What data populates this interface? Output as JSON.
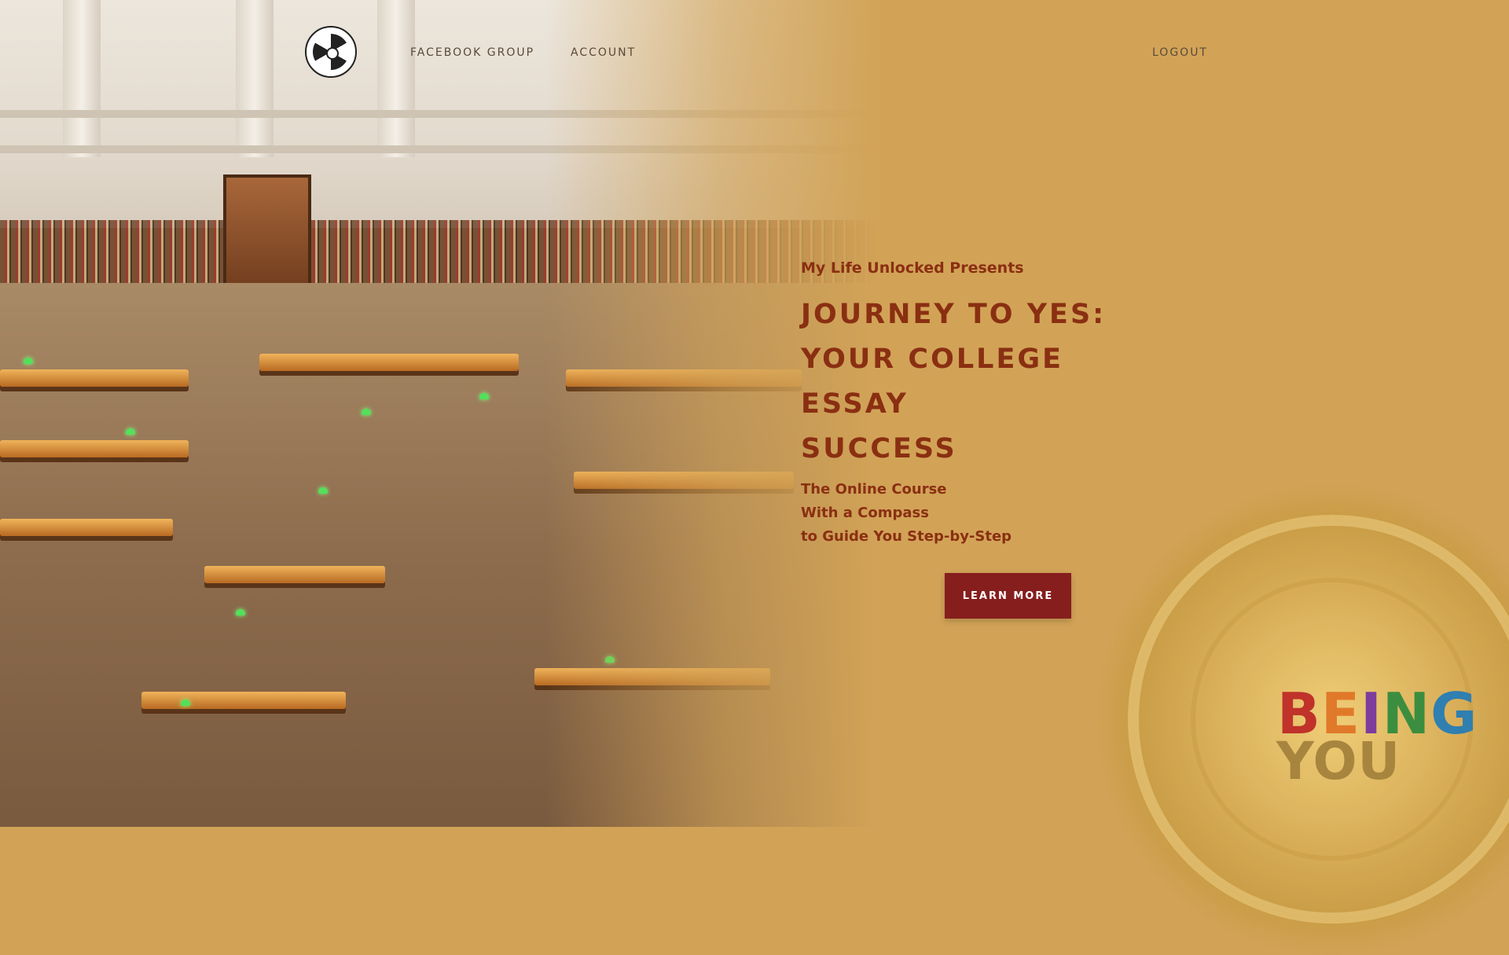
{
  "nav": {
    "facebook_group": "FACEBOOK GROUP",
    "account": "ACCOUNT",
    "logout": "LOGOUT"
  },
  "hero": {
    "presents": "My Life Unlocked Presents",
    "headline_lines": [
      "JOURNEY TO YES:",
      "YOUR COLLEGE",
      "ESSAY",
      "SUCCESS"
    ],
    "subtitle_lines": [
      "The Online Course",
      "With a Compass",
      "to Guide You Step-by-Step"
    ],
    "cta_label": "LEARN MORE"
  },
  "brand": {
    "word1_letters": [
      "B",
      "E",
      "I",
      "N",
      "G"
    ],
    "word1_colors": [
      "#c0322a",
      "#e07a2a",
      "#7d3d9c",
      "#3b8e3f",
      "#2f7fb0"
    ],
    "word2": "YOU"
  },
  "colors": {
    "background": "#d2a357",
    "headline": "#8a2f12",
    "cta": "#861e1e"
  }
}
